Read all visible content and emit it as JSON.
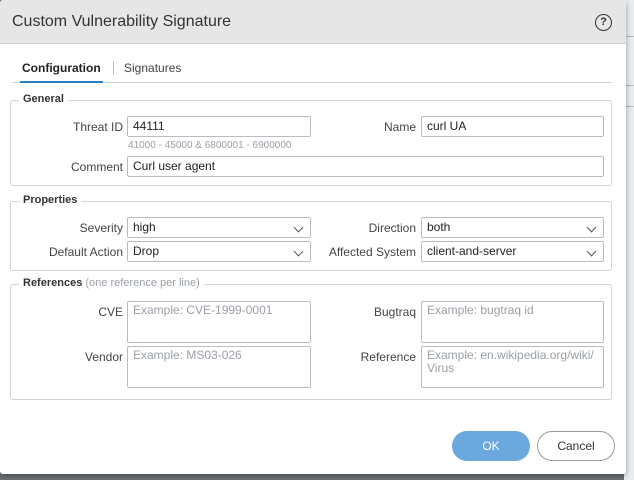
{
  "dialog": {
    "title": "Custom Vulnerability Signature"
  },
  "tabs": [
    {
      "label": "Configuration",
      "active": true
    },
    {
      "label": "Signatures",
      "active": false
    }
  ],
  "general": {
    "legend": "General",
    "threat_id_label": "Threat ID",
    "threat_id_value": "44111",
    "threat_id_hint": "41000 - 45000 & 6800001 - 6900000",
    "name_label": "Name",
    "name_value": "curl UA",
    "comment_label": "Comment",
    "comment_value": "Curl user agent"
  },
  "properties": {
    "legend": "Properties",
    "severity_label": "Severity",
    "severity_value": "high",
    "direction_label": "Direction",
    "direction_value": "both",
    "default_action_label": "Default Action",
    "default_action_value": "Drop",
    "affected_system_label": "Affected System",
    "affected_system_value": "client-and-server"
  },
  "references": {
    "legend": "References",
    "legend_hint": "(one reference per line)",
    "cve_label": "CVE",
    "cve_placeholder": "Example: CVE-1999-0001",
    "bugtraq_label": "Bugtraq",
    "bugtraq_placeholder": "Example: bugtraq id",
    "vendor_label": "Vendor",
    "vendor_placeholder": "Example: MS03-026",
    "reference_label": "Reference",
    "reference_placeholder": "Example: en.wikipedia.org/wiki/Virus"
  },
  "buttons": {
    "ok": "OK",
    "cancel": "Cancel"
  },
  "colors": {
    "accent": "#2b7fc7",
    "ok_button": "#6aa8de",
    "titlebar": "#e6e6e6"
  }
}
